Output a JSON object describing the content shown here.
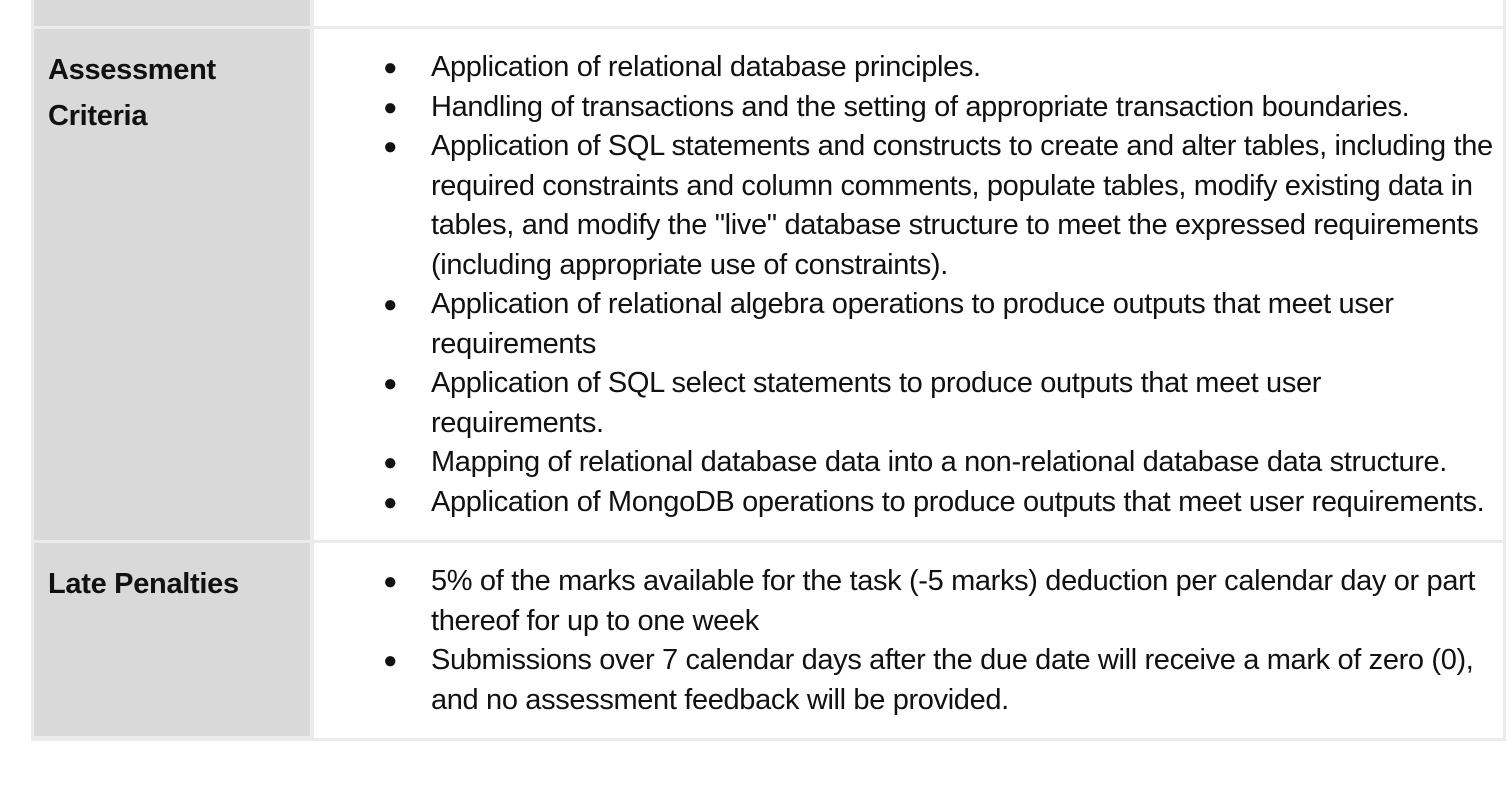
{
  "table": {
    "rows": [
      {
        "label": "Assessment Criteria",
        "bullet": "●",
        "items": [
          "Application of relational database principles.",
          "Handling of transactions and the setting of appropriate transaction boundaries.",
          "Application of SQL statements and constructs to create and alter tables, including the required constraints and column comments, populate tables, modify existing data in tables, and modify the \"live\" database structure to meet the expressed requirements (including appropriate use of constraints).",
          "Application of relational algebra operations to produce outputs that meet user requirements",
          "Application of SQL select statements to produce outputs that meet user requirements.",
          "Mapping of relational database data into a non-relational database data structure.",
          "Application of MongoDB operations to produce outputs that meet user requirements."
        ]
      },
      {
        "label": "Late Penalties",
        "bullet": "●",
        "items": [
          "5% of the marks available for the task (-5 marks) deduction per calendar day or part thereof for up to one week",
          "Submissions over 7 calendar days after the due date will receive a mark of zero (0), and no assessment feedback will be provided."
        ]
      }
    ]
  }
}
